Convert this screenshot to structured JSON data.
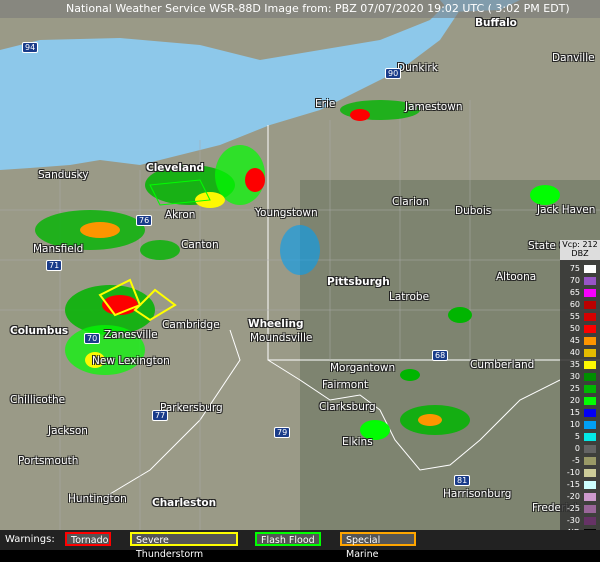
{
  "header": {
    "title": "National Weather Service WSR-88D Image from: PBZ 07/07/2020 19:02 UTC ( 3:02 PM EDT)"
  },
  "cities": [
    {
      "name": "Buffalo"
    },
    {
      "name": "Dunkirk"
    },
    {
      "name": "Danville"
    },
    {
      "name": "Erie"
    },
    {
      "name": "Jamestown"
    },
    {
      "name": "Sandusky"
    },
    {
      "name": "Cleveland"
    },
    {
      "name": "Akron"
    },
    {
      "name": "Youngstown"
    },
    {
      "name": "Clarion"
    },
    {
      "name": "Dubois"
    },
    {
      "name": "Jack Haven"
    },
    {
      "name": "Mansfield"
    },
    {
      "name": "Canton"
    },
    {
      "name": "State College"
    },
    {
      "name": "Pittsburgh"
    },
    {
      "name": "Altoona"
    },
    {
      "name": "Latrobe"
    },
    {
      "name": "Columbus"
    },
    {
      "name": "Zanesville"
    },
    {
      "name": "Cambridge"
    },
    {
      "name": "Wheeling"
    },
    {
      "name": "Moundsville"
    },
    {
      "name": "New Lexington"
    },
    {
      "name": "Morgantown"
    },
    {
      "name": "Cumberland"
    },
    {
      "name": "Fairmont"
    },
    {
      "name": "Chillicothe"
    },
    {
      "name": "Parkersburg"
    },
    {
      "name": "Clarksburg"
    },
    {
      "name": "Jackson"
    },
    {
      "name": "Portsmouth"
    },
    {
      "name": "Elkins"
    },
    {
      "name": "Huntington"
    },
    {
      "name": "Charleston"
    },
    {
      "name": "Harrisonburg"
    },
    {
      "name": "Frederick"
    }
  ],
  "highways": [
    "94",
    "90",
    "76",
    "71",
    "70",
    "77",
    "79",
    "81",
    "68"
  ],
  "warnings": {
    "label": "Warnings:",
    "items": [
      {
        "label": "Tornado",
        "color": "#ff0000"
      },
      {
        "label": "Severe Thunderstorm",
        "color": "#ffff00"
      },
      {
        "label": "Flash Flood",
        "color": "#00ff00"
      },
      {
        "label": "Special Marine",
        "color": "#ffa500"
      }
    ]
  },
  "legend": {
    "header_top": "Vcp: 212",
    "header_bottom": "DBZ",
    "rows": [
      {
        "value": "75",
        "color": "#fdfdfd"
      },
      {
        "value": "70",
        "color": "#9854c6"
      },
      {
        "value": "65",
        "color": "#f800fd"
      },
      {
        "value": "60",
        "color": "#bc0000"
      },
      {
        "value": "55",
        "color": "#d40000"
      },
      {
        "value": "50",
        "color": "#fd0000"
      },
      {
        "value": "45",
        "color": "#fd9500"
      },
      {
        "value": "40",
        "color": "#e5bc00"
      },
      {
        "value": "35",
        "color": "#fdf802"
      },
      {
        "value": "30",
        "color": "#008e00"
      },
      {
        "value": "25",
        "color": "#01b501"
      },
      {
        "value": "20",
        "color": "#02fd02"
      },
      {
        "value": "15",
        "color": "#0300f4"
      },
      {
        "value": "10",
        "color": "#019ff4"
      },
      {
        "value": "5",
        "color": "#04e9e7"
      },
      {
        "value": "0",
        "color": "#646464"
      },
      {
        "value": "-5",
        "color": "#999966"
      },
      {
        "value": "-10",
        "color": "#cccc99"
      },
      {
        "value": "-15",
        "color": "#ccffff"
      },
      {
        "value": "-20",
        "color": "#cc99cc"
      },
      {
        "value": "-25",
        "color": "#996699"
      },
      {
        "value": "-30",
        "color": "#663366"
      },
      {
        "value": "ND",
        "color": "#000000"
      }
    ]
  }
}
